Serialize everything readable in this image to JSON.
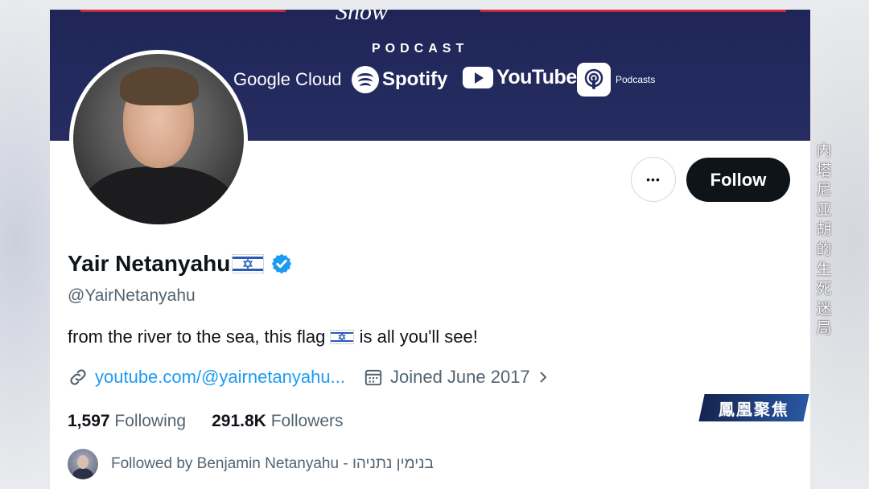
{
  "banner": {
    "show_text": "Show",
    "podcast_label": "PODCAST",
    "platforms": [
      "Google Cloud",
      "Spotify",
      "YouTube",
      "Podcasts"
    ]
  },
  "profile": {
    "display_name": "Yair Netanyahu",
    "handle": "@YairNetanyahu",
    "bio_before": "from the river to the sea, this flag ",
    "bio_after": " is all you'll see!",
    "link": "youtube.com/@yairnetanyahu...",
    "joined": "Joined June 2017",
    "following_count": "1,597",
    "following_label": "Following",
    "followers_count": "291.8K",
    "followers_label": "Followers",
    "followed_by": "Followed by Benjamin Netanyahu - בנימין נתניהו"
  },
  "actions": {
    "follow_label": "Follow",
    "more_label": "•••"
  },
  "overlay": {
    "side_caption": [
      "内",
      "塔",
      "尼",
      "亚",
      "胡",
      "的",
      "生",
      "死",
      "迷",
      "局"
    ],
    "logo_text": "鳳凰聚焦"
  },
  "colors": {
    "banner": "#232a5e",
    "accent_blue": "#1d9bf0",
    "follow_button": "#0f1419",
    "flag_blue": "#2a5bb8"
  }
}
